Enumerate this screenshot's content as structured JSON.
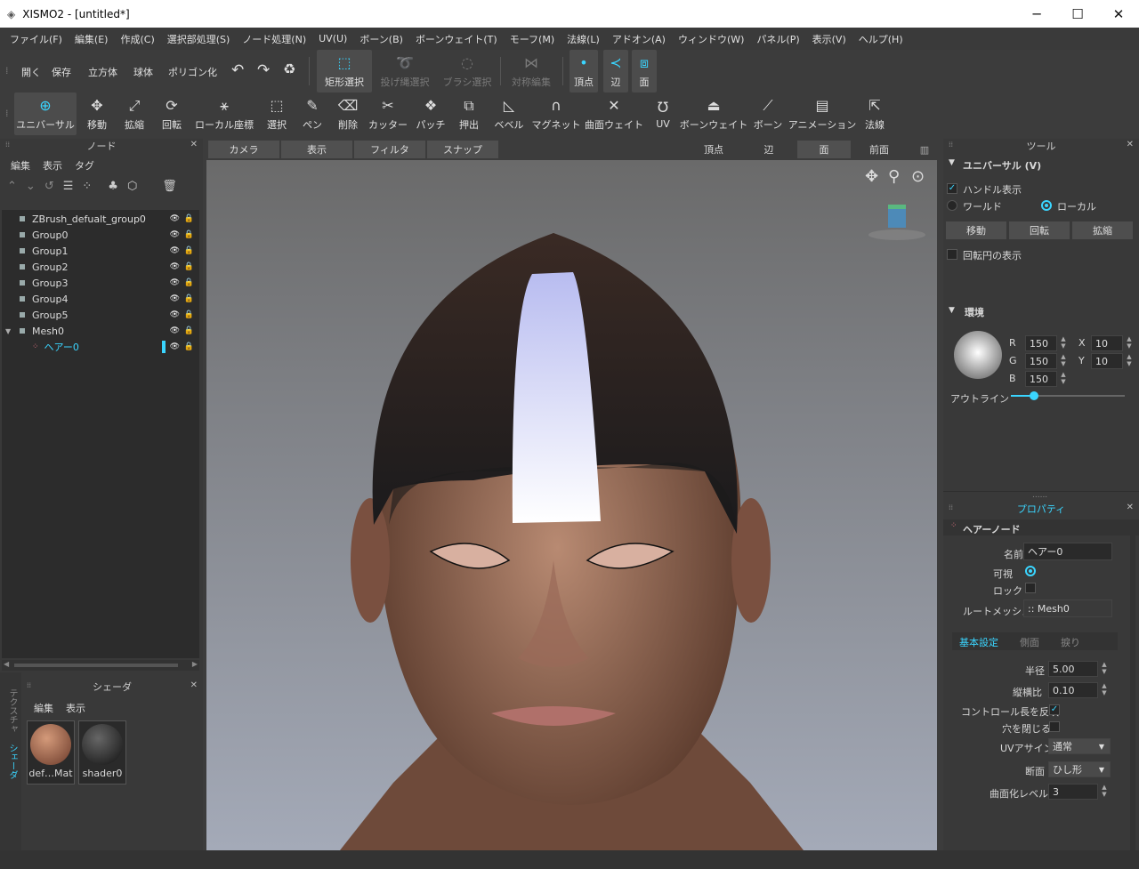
{
  "window": {
    "title": "XISMO2 - [untitled*]",
    "minimize": "─",
    "maximize": "☐",
    "close": "✕"
  },
  "menu": [
    "ファイル(F)",
    "編集(E)",
    "作成(C)",
    "選択部処理(S)",
    "ノード処理(N)",
    "UV(U)",
    "ボーン(B)",
    "ボーンウェイト(T)",
    "モーフ(M)",
    "法線(L)",
    "アドオン(A)",
    "ウィンドウ(W)",
    "パネル(P)",
    "表示(V)",
    "ヘルプ(H)"
  ],
  "toolbar1": {
    "file_actions": [
      "開く",
      "保存",
      "立方体",
      "球体",
      "ポリゴン化"
    ],
    "select_tools": [
      "矩形選択",
      "投げ縄選択",
      "ブラシ選択"
    ],
    "symmetry": "対称編集",
    "modes": [
      "頂点",
      "辺",
      "面"
    ]
  },
  "toolbar2": [
    "ユニバーサル",
    "移動",
    "拡縮",
    "回転",
    "ローカル座標",
    "選択",
    "ペン",
    "削除",
    "カッター",
    "パッチ",
    "押出",
    "ベベル",
    "マグネット",
    "曲面ウェイト",
    "UV",
    "ボーンウェイト",
    "ボーン",
    "アニメーション",
    "法線"
  ],
  "node_panel": {
    "title": "ノード",
    "menus": [
      "編集",
      "表示",
      "タグ"
    ],
    "nodes": [
      {
        "name": "ZBrush_defualt_group0"
      },
      {
        "name": "Group0"
      },
      {
        "name": "Group1"
      },
      {
        "name": "Group2"
      },
      {
        "name": "Group3"
      },
      {
        "name": "Group4"
      },
      {
        "name": "Group5"
      },
      {
        "name": "Mesh0"
      },
      {
        "name": "ヘアー0",
        "selected": true
      }
    ]
  },
  "shader_panel": {
    "title": "シェーダ",
    "menus": [
      "編集",
      "表示"
    ],
    "side_tabs": [
      "テクスチャ",
      "シェーダ"
    ],
    "items": [
      "def…Mat",
      "shader0"
    ]
  },
  "viewport": {
    "left_tabs": [
      "カメラ",
      "表示",
      "フィルタ",
      "スナップ"
    ],
    "right_tabs": [
      "頂点",
      "辺",
      "面",
      "前面"
    ]
  },
  "tool_panel": {
    "title": "ツール",
    "section": "ユニバーサル (V)",
    "handle_display": "ハンドル表示",
    "world": "ワールド",
    "local": "ローカル",
    "buttons": [
      "移動",
      "回転",
      "拡縮"
    ],
    "rotation_circle": "回転円の表示",
    "env_title": "環境",
    "rgb": {
      "R": "150",
      "G": "150",
      "B": "150"
    },
    "xy": {
      "X": "10",
      "Y": "10"
    },
    "outline": "アウトライン",
    "outline_level": 0.2
  },
  "property_panel": {
    "title": "プロパティ",
    "node_type": "ヘアーノード",
    "name_label": "名前",
    "name_value": "ヘアー0",
    "visible_label": "可視",
    "lock_label": "ロック",
    "root_label": "ルートメッシュ",
    "root_value": ":: Mesh0",
    "tabs": [
      "基本設定",
      "側面",
      "捩り"
    ],
    "radius_label": "半径",
    "radius": "5.00",
    "aspect_label": "縦横比",
    "aspect": "0.10",
    "control_label": "コントロール長を反映",
    "close_label": "穴を閉じる",
    "uv_label": "UVアサイン",
    "uv_value": "通常",
    "section_label": "断面",
    "section_value": "ひし形",
    "subdiv_label": "曲面化レベル",
    "subdiv_value": "3"
  },
  "colors": {
    "accent": "#3ad5ff",
    "bg": "#3c3c3c"
  }
}
